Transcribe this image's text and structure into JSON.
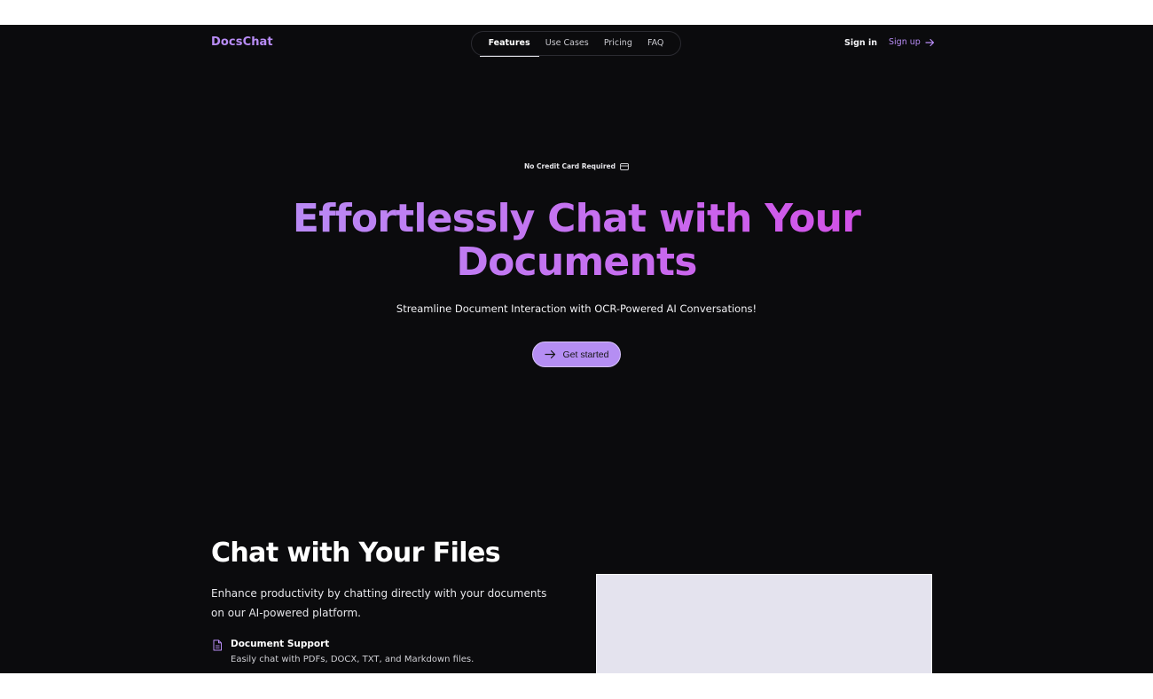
{
  "header": {
    "brand": "DocsChat",
    "nav": [
      {
        "label": "Features",
        "active": true
      },
      {
        "label": "Use Cases",
        "active": false
      },
      {
        "label": "Pricing",
        "active": false
      },
      {
        "label": "FAQ",
        "active": false
      }
    ],
    "sign_in": "Sign in",
    "sign_up": "Sign up",
    "sign_up_icon": "arrow-right-icon"
  },
  "hero": {
    "badge": "No Credit Card Required",
    "badge_icon": "credit-card-icon",
    "title_line1": "Effortlessly Chat with Your",
    "title_line2": "Documents",
    "subtitle": "Streamline Document Interaction with OCR-Powered AI Conversations!",
    "cta_label": "Get started",
    "cta_icon": "arrow-right-icon"
  },
  "feature_section": {
    "title": "Chat with Your Files",
    "description": "Enhance productivity by chatting directly with your documents on our AI-powered platform.",
    "items": [
      {
        "icon": "document-icon",
        "title": "Document Support",
        "description": "Easily chat with PDFs, DOCX, TXT, and Markdown files."
      }
    ]
  },
  "colors": {
    "background": "#0b0b0d",
    "accent": "#b88cf5",
    "gradient_end": "#d34ee6",
    "preview_panel": "#e4e3ee"
  }
}
